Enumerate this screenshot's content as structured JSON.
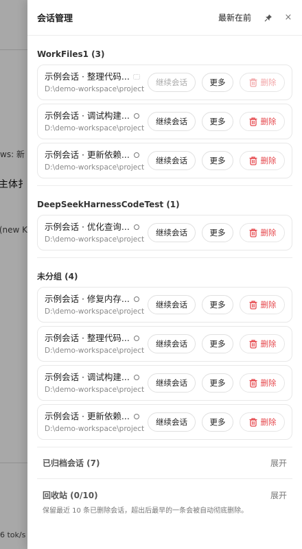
{
  "background": {
    "fragments": [
      "ws: 新",
      "F主体扌",
      "(new K",
      "6 tok/s"
    ]
  },
  "drawer": {
    "title": "会话管理",
    "sort_label": "最新在前",
    "pin_icon": "pin-icon",
    "close_label": "×"
  },
  "buttons": {
    "continue": "继续会话",
    "more": "更多",
    "delete": "删除"
  },
  "groups": [
    {
      "title": "WorkFiles1 (3)",
      "sessions": [
        {
          "title": "示例会话 · 整理代码...",
          "path": "D:\\demo-workspace\\project",
          "status": "busy"
        },
        {
          "title": "示例会话 · 调试构建...",
          "path": "D:\\demo-workspace\\project",
          "status": "idle"
        },
        {
          "title": "示例会话 · 更新依赖...",
          "path": "D:\\demo-workspace\\project",
          "status": "idle"
        }
      ]
    },
    {
      "title": "DeepSeekHarnessCodeTest (1)",
      "sessions": [
        {
          "title": "示例会话 · 优化查询...",
          "path": "D:\\demo-workspace\\project",
          "status": "idle"
        }
      ]
    },
    {
      "title": "未分组 (4)",
      "sessions": [
        {
          "title": "示例会话 · 修复内存...",
          "path": "D:\\demo-workspace\\project",
          "status": "idle"
        },
        {
          "title": "示例会话 · 整理代码...",
          "path": "D:\\demo-workspace\\project",
          "status": "idle"
        },
        {
          "title": "示例会话 · 调试构建...",
          "path": "D:\\demo-workspace\\project",
          "status": "idle"
        },
        {
          "title": "示例会话 · 更新依赖...",
          "path": "D:\\demo-workspace\\project",
          "status": "idle"
        }
      ]
    }
  ],
  "archived": {
    "label": "已归档会话 (7)",
    "action": "展开"
  },
  "trash": {
    "label": "回收站 (0/10)",
    "action": "展开",
    "note": "保留最近 10 条已删除会话，超出后最早的一条会被自动彻底删除。"
  },
  "colors": {
    "danger": "#e5484d",
    "border": "#e8e8e8"
  }
}
